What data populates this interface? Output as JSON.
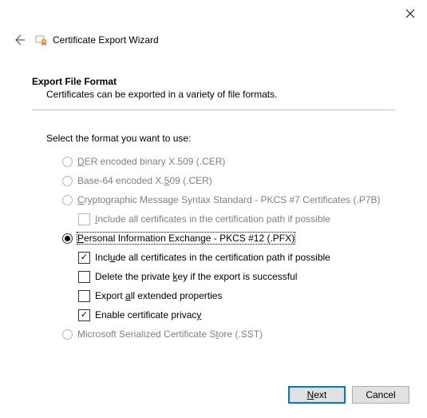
{
  "window": {
    "title": "Certificate Export Wizard"
  },
  "section": {
    "heading": "Export File Format",
    "description": "Certificates can be exported in a variety of file formats.",
    "prompt": "Select the format you want to use:"
  },
  "options": {
    "der": {
      "prefix": "",
      "accel": "D",
      "suffix": "ER encoded binary X.509 (.CER)"
    },
    "base64": {
      "prefix": "Base-64 encoded X.",
      "accel": "5",
      "suffix": "09 (.CER)"
    },
    "pkcs7": {
      "prefix": "",
      "accel": "C",
      "suffix": "ryptographic Message Syntax Standard - PKCS #7 Certificates (.P7B)"
    },
    "pkcs7_include": {
      "prefix": "",
      "accel": "I",
      "suffix": "nclude all certificates in the certification path if possible"
    },
    "pfx": {
      "prefix": "",
      "accel": "P",
      "suffix": "ersonal Information Exchange - PKCS #12 (.PFX)"
    },
    "pfx_include": {
      "prefix": "Incl",
      "accel": "u",
      "suffix": "de all certificates in the certification path if possible"
    },
    "pfx_delete": {
      "prefix": "Delete the private ",
      "accel": "k",
      "suffix": "ey if the export is successful"
    },
    "pfx_extended": {
      "prefix": "Export ",
      "accel": "a",
      "suffix": "ll extended properties"
    },
    "pfx_privacy": {
      "prefix": "Enable certificate privac",
      "accel": "y",
      "suffix": ""
    },
    "sst": {
      "prefix": "Microsoft Serialized Certificate S",
      "accel": "t",
      "suffix": "ore (.SST)"
    }
  },
  "buttons": {
    "next": {
      "accel": "N",
      "suffix": "ext"
    },
    "cancel": "Cancel"
  }
}
